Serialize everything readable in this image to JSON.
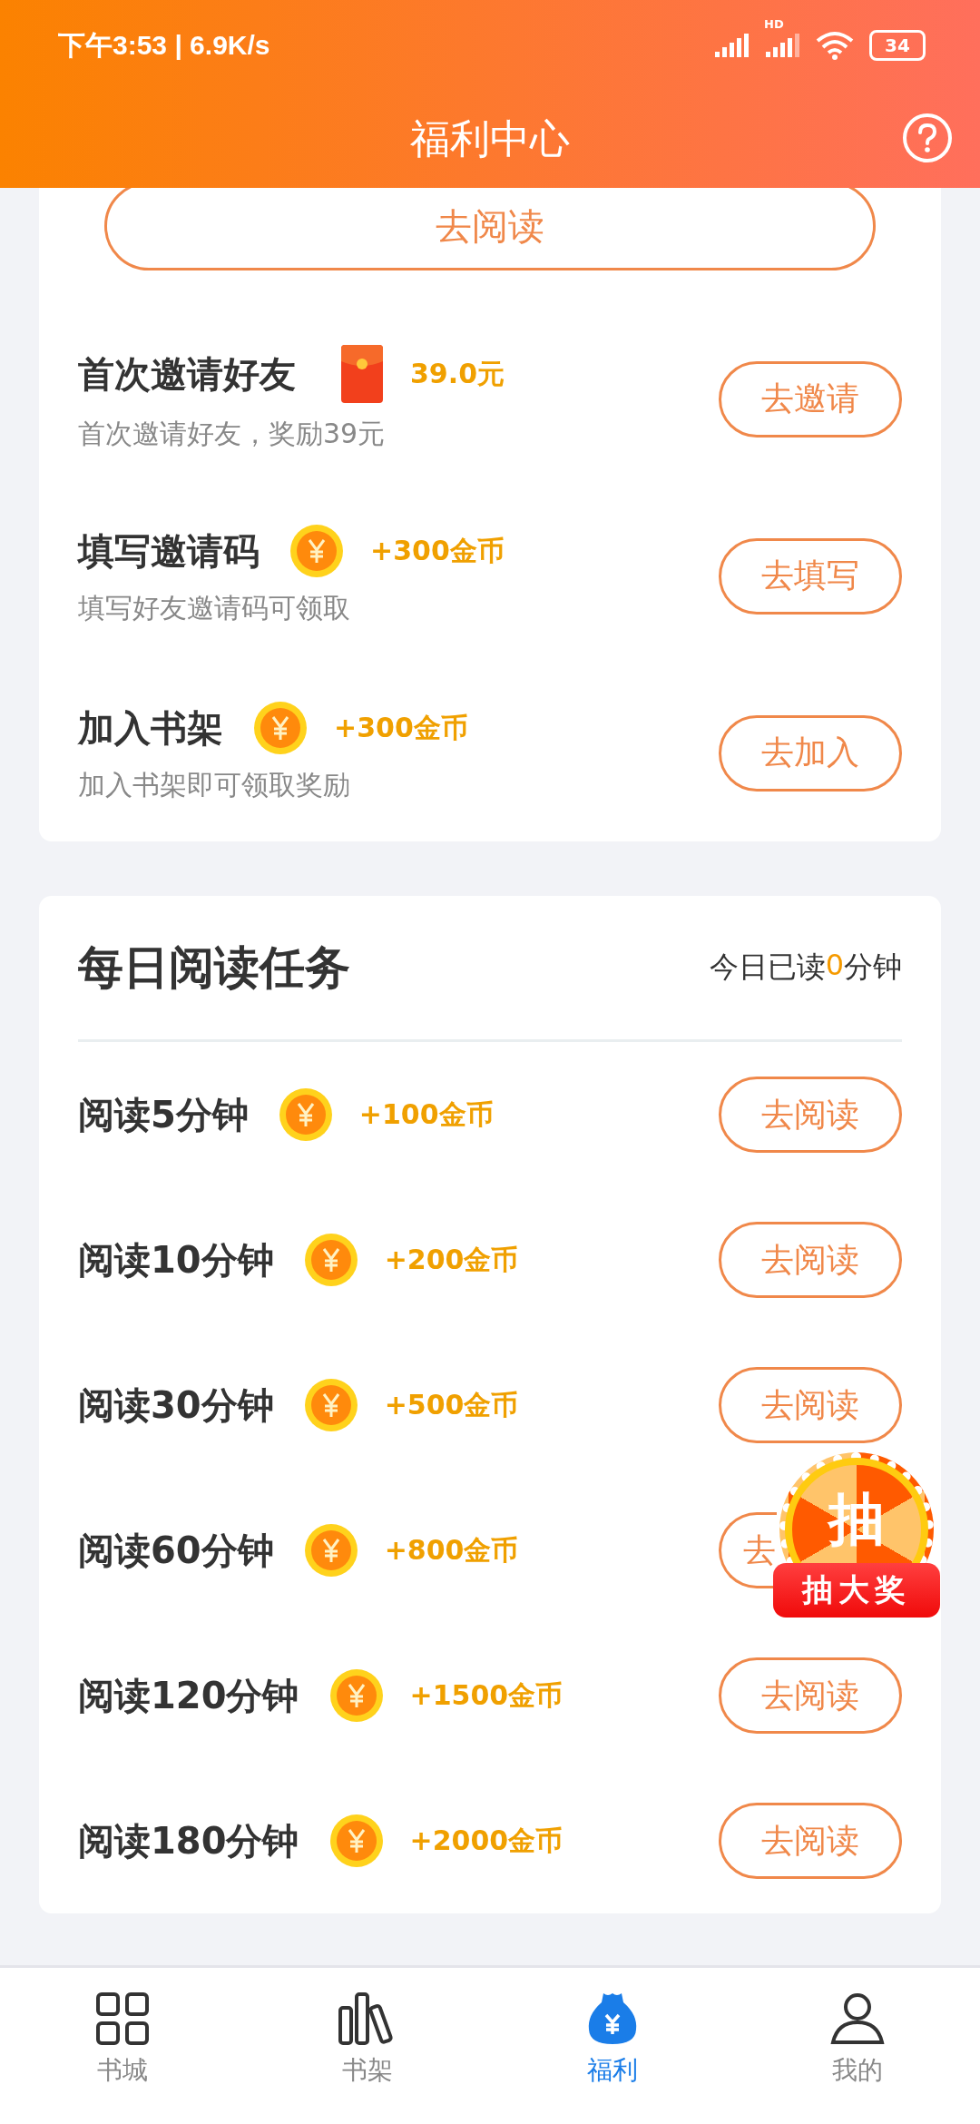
{
  "status_bar": {
    "time": "下午3:53 | 6.9K/s",
    "network": "HD",
    "battery": "34"
  },
  "header": {
    "title": "福利中心"
  },
  "top_button": {
    "label": "去阅读"
  },
  "invite_tasks": [
    {
      "title": "首次邀请好友",
      "kind": "envelope",
      "reward": "39.0元",
      "subtitle": "首次邀请好友，奖励39元",
      "button": "去邀请"
    },
    {
      "title": "填写邀请码",
      "kind": "coin",
      "reward": "+300金币",
      "subtitle": "填写好友邀请码可领取",
      "button": "去填写"
    },
    {
      "title": "加入书架",
      "kind": "coin",
      "reward": "+300金币",
      "subtitle": "加入书架即可领取奖励",
      "button": "去加入"
    }
  ],
  "daily": {
    "title": "每日阅读任务",
    "progress": {
      "prefix": "今日已读",
      "minutes": "0",
      "suffix": "分钟"
    },
    "tasks": [
      {
        "title": "阅读5分钟",
        "reward": "+100金币",
        "button": "去阅读",
        "kind": "full"
      },
      {
        "title": "阅读10分钟",
        "reward": "+200金币",
        "button": "去阅读",
        "kind": "full"
      },
      {
        "title": "阅读30分钟",
        "reward": "+500金币",
        "button": "去阅读",
        "kind": "full"
      },
      {
        "title": "阅读60分钟",
        "reward": "+800金币",
        "button": "去",
        "kind": "partial"
      },
      {
        "title": "阅读120分钟",
        "reward": "+1500金币",
        "button": "去阅读",
        "kind": "full"
      },
      {
        "title": "阅读180分钟",
        "reward": "+2000金币",
        "button": "去阅读",
        "kind": "full"
      }
    ]
  },
  "lottery": {
    "wheel_char": "抽",
    "label": "抽大奖"
  },
  "nav": [
    {
      "label": "书城",
      "kind": "grid",
      "selected": false
    },
    {
      "label": "书架",
      "kind": "books",
      "selected": false
    },
    {
      "label": "福利",
      "kind": "bag",
      "selected": true
    },
    {
      "label": "我的",
      "kind": "person",
      "selected": false
    }
  ]
}
